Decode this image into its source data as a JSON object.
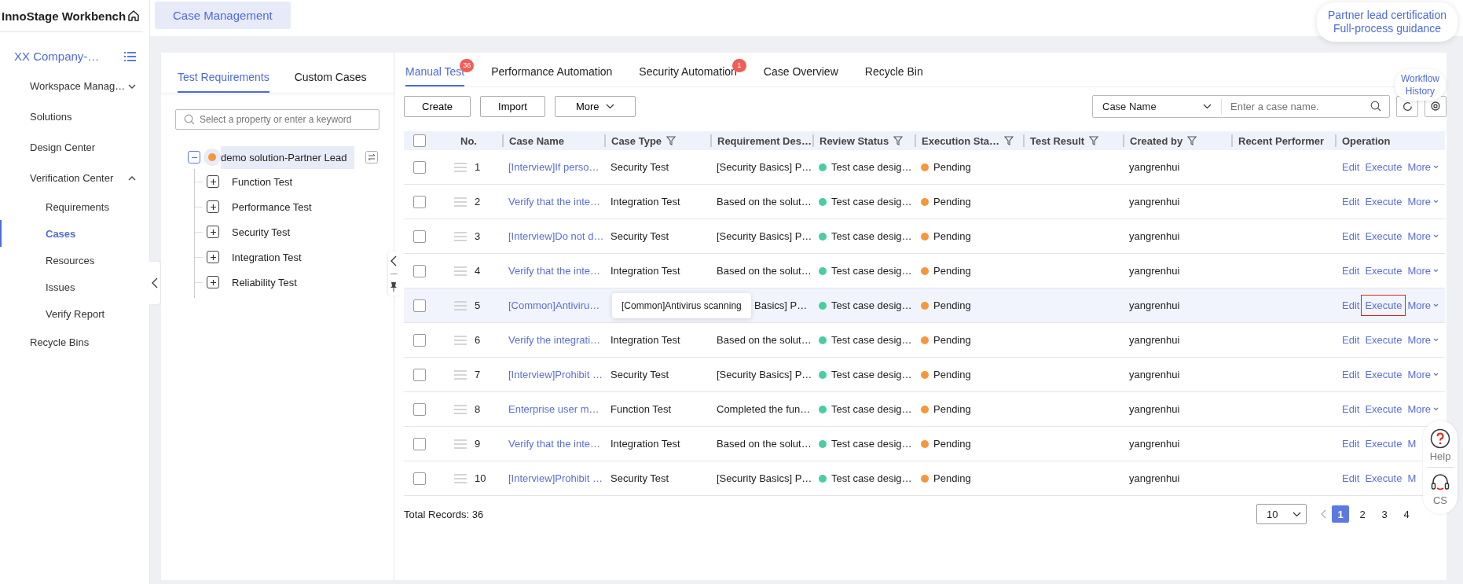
{
  "app": {
    "title": "InnoStage Workbench",
    "page_tab": "Case Management"
  },
  "sidebar": {
    "project": "XX Company-…",
    "items": [
      {
        "label": "Workspace Manag…",
        "selected": false,
        "expanded": false
      },
      {
        "label": "Solutions",
        "selected": false
      },
      {
        "label": "Design Center",
        "selected": false
      },
      {
        "label": "Verification Center",
        "selected": false,
        "expanded": true,
        "children": [
          {
            "label": "Requirements",
            "selected": false
          },
          {
            "label": "Cases",
            "selected": true
          },
          {
            "label": "Resources",
            "selected": false
          },
          {
            "label": "Issues",
            "selected": false
          },
          {
            "label": "Verify Report",
            "selected": false
          }
        ]
      },
      {
        "label": "Recycle Bins",
        "selected": false
      }
    ]
  },
  "tree_panel": {
    "tabs": [
      {
        "label": "Test Requirements",
        "selected": true
      },
      {
        "label": "Custom Cases",
        "selected": false
      }
    ],
    "search": {
      "placeholder": "Select a property or enter a keyword"
    },
    "root": {
      "label": "demo solution-Partner Lead",
      "expanded": true,
      "selected": true,
      "color": "#f7963b",
      "children": [
        {
          "label": "Function Test",
          "expanded": false
        },
        {
          "label": "Performance Test",
          "expanded": false
        },
        {
          "label": "Security Test",
          "expanded": false
        },
        {
          "label": "Integration Test",
          "expanded": false
        },
        {
          "label": "Reliability Test",
          "expanded": false
        }
      ]
    }
  },
  "tabs": [
    {
      "label": "Manual Test",
      "selected": true,
      "badge": "36"
    },
    {
      "label": "Performance Automation",
      "selected": false
    },
    {
      "label": "Security Automation",
      "selected": false,
      "badge": "1"
    },
    {
      "label": "Case Overview",
      "selected": false
    },
    {
      "label": "Recycle Bin",
      "selected": false
    }
  ],
  "toolbar": {
    "buttons": [
      {
        "label": "Create",
        "dropdown": false
      },
      {
        "label": "Import",
        "dropdown": false
      },
      {
        "label": "More",
        "dropdown": true
      }
    ],
    "search_by": "Case Name",
    "search": {
      "placeholder": "Enter a case name."
    }
  },
  "table": {
    "all_checked": false,
    "columns": [
      {
        "label": "No.",
        "filter": false
      },
      {
        "label": "Case Name",
        "filter": false
      },
      {
        "label": "Case Type",
        "filter": true
      },
      {
        "label": "Requirement Des…"
      },
      {
        "label": "Review Status",
        "filter": true
      },
      {
        "label": "Execution Sta…",
        "filter": true
      },
      {
        "label": "Test Result",
        "filter": true
      },
      {
        "label": "Created by",
        "filter": true
      },
      {
        "label": "Recent Performer",
        "filter": false
      },
      {
        "label": "Operation",
        "filter": false
      }
    ],
    "rows": [
      {
        "no": "1",
        "checked": false,
        "hovered": false,
        "name": "[Interview]If perso…",
        "type": "Security Test",
        "requirement": "[Security Basics] P…",
        "review": {
          "text": "Test case desig…",
          "color": "#48cf9b"
        },
        "execution": {
          "text": "Pending",
          "color": "#f7963b"
        },
        "created_by": "yangrenhui",
        "actions": [
          "Edit",
          "Execute",
          "More"
        ],
        "more_caret": true
      },
      {
        "no": "2",
        "checked": false,
        "hovered": false,
        "name": "Verify that the inte…",
        "type": "Integration Test",
        "requirement": "Based on the solut…",
        "review": {
          "text": "Test case desig…",
          "color": "#48cf9b"
        },
        "execution": {
          "text": "Pending",
          "color": "#f7963b"
        },
        "created_by": "yangrenhui",
        "actions": [
          "Edit",
          "Execute",
          "More"
        ],
        "more_caret": true
      },
      {
        "no": "3",
        "checked": false,
        "hovered": false,
        "name": "[Interview]Do not d…",
        "type": "Security Test",
        "requirement": "[Security Basics] P…",
        "review": {
          "text": "Test case desig…",
          "color": "#48cf9b"
        },
        "execution": {
          "text": "Pending",
          "color": "#f7963b"
        },
        "created_by": "yangrenhui",
        "actions": [
          "Edit",
          "Execute",
          "More"
        ],
        "more_caret": true
      },
      {
        "no": "4",
        "checked": false,
        "hovered": false,
        "name": "Verify that the inte…",
        "type": "Integration Test",
        "requirement": "Based on the solut…",
        "review": {
          "text": "Test case desig…",
          "color": "#48cf9b"
        },
        "execution": {
          "text": "Pending",
          "color": "#f7963b"
        },
        "created_by": "yangrenhui",
        "actions": [
          "Edit",
          "Execute",
          "More"
        ],
        "more_caret": true
      },
      {
        "no": "5",
        "checked": false,
        "hovered": true,
        "name": "[Common]Antiviru…",
        "tooltip": "[Common]Antivirus scanning",
        "requirement": "Basics] P…",
        "review": {
          "text": "Test case desig…",
          "color": "#48cf9b"
        },
        "execution": {
          "text": "Pending",
          "color": "#f7963b"
        },
        "created_by": "yangrenhui",
        "actions": [
          "Edit",
          "Execute",
          "More"
        ],
        "more_caret": true,
        "execute_outlined": true
      },
      {
        "no": "6",
        "checked": false,
        "hovered": false,
        "name": "Verify the integrati…",
        "type": "Integration Test",
        "requirement": "Based on the solut…",
        "review": {
          "text": "Test case desig…",
          "color": "#48cf9b"
        },
        "execution": {
          "text": "Pending",
          "color": "#f7963b"
        },
        "created_by": "yangrenhui",
        "actions": [
          "Edit",
          "Execute",
          "More"
        ],
        "more_caret": true
      },
      {
        "no": "7",
        "checked": false,
        "hovered": false,
        "name": "[Interview]Prohibit …",
        "type": "Security Test",
        "requirement": "[Security Basics] P…",
        "review": {
          "text": "Test case desig…",
          "color": "#48cf9b"
        },
        "execution": {
          "text": "Pending",
          "color": "#f7963b"
        },
        "created_by": "yangrenhui",
        "actions": [
          "Edit",
          "Execute",
          "More"
        ],
        "more_caret": true
      },
      {
        "no": "8",
        "checked": false,
        "hovered": false,
        "name": "Enterprise user m…",
        "type": "Function Test",
        "requirement": "Completed the fun…",
        "review": {
          "text": "Test case desig…",
          "color": "#48cf9b"
        },
        "execution": {
          "text": "Pending",
          "color": "#f7963b"
        },
        "created_by": "yangrenhui",
        "actions": [
          "Edit",
          "Execute",
          "More"
        ],
        "more_caret": true
      },
      {
        "no": "9",
        "checked": false,
        "hovered": false,
        "name": "Verify that the inte…",
        "type": "Integration Test",
        "requirement": "Based on the solut…",
        "review": {
          "text": "Test case desig…",
          "color": "#48cf9b"
        },
        "execution": {
          "text": "Pending",
          "color": "#f7963b"
        },
        "created_by": "yangrenhui",
        "actions": [
          "Edit",
          "Execute",
          "M"
        ],
        "more_caret": false
      },
      {
        "no": "10",
        "checked": false,
        "hovered": false,
        "name": "[Interview]Prohibit …",
        "type": "Security Test",
        "requirement": "[Security Basics] P…",
        "review": {
          "text": "Test case desig…",
          "color": "#48cf9b"
        },
        "execution": {
          "text": "Pending",
          "color": "#f7963b"
        },
        "created_by": "yangrenhui",
        "actions": [
          "Edit",
          "Execute",
          "M"
        ],
        "more_caret": false
      }
    ]
  },
  "footer": {
    "total": "Total Records: 36",
    "page_size": "10",
    "pages": [
      {
        "label": "1",
        "selected": true
      },
      {
        "label": "2",
        "selected": false
      },
      {
        "label": "3",
        "selected": false
      },
      {
        "label": "4",
        "selected": false
      }
    ]
  },
  "floating": {
    "guide": [
      "Partner lead certification",
      "Full-process guidance"
    ],
    "workflow": [
      "Workflow",
      "History"
    ],
    "help": "Help",
    "cs": "CS"
  }
}
